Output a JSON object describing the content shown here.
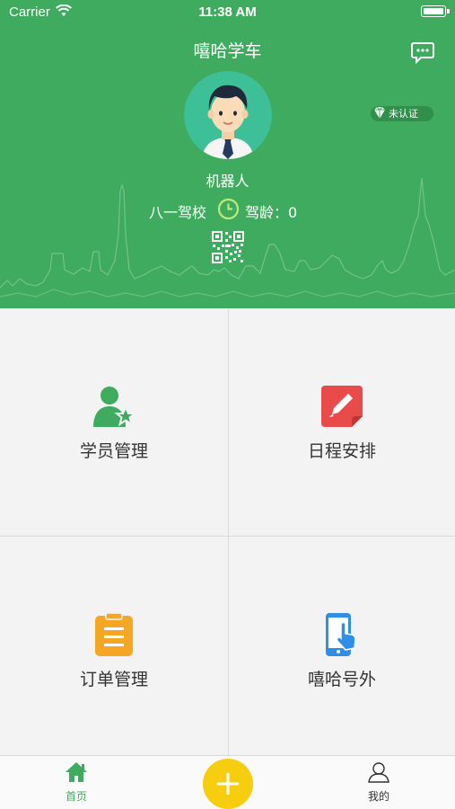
{
  "status_bar": {
    "carrier": "Carrier",
    "time": "11:38 AM"
  },
  "header": {
    "title": "嘻哈学车",
    "badge": "未认证",
    "name": "机器人",
    "school": "八一驾校",
    "driving_age": "驾龄：0",
    "color": "#3fab5e"
  },
  "menu": {
    "students": "学员管理",
    "schedule": "日程安排",
    "orders": "订单管理",
    "news": "嘻哈号外"
  },
  "tabbar": {
    "home": "首页",
    "mine": "我的"
  },
  "icons": [
    "wifi-icon",
    "battery-icon",
    "chat-icon",
    "avatar",
    "diamond-icon",
    "clock-icon",
    "qr-code-icon",
    "student-star-icon",
    "edit-note-icon",
    "clipboard-icon",
    "phone-tap-icon",
    "home-icon",
    "plus-icon",
    "user-icon"
  ]
}
